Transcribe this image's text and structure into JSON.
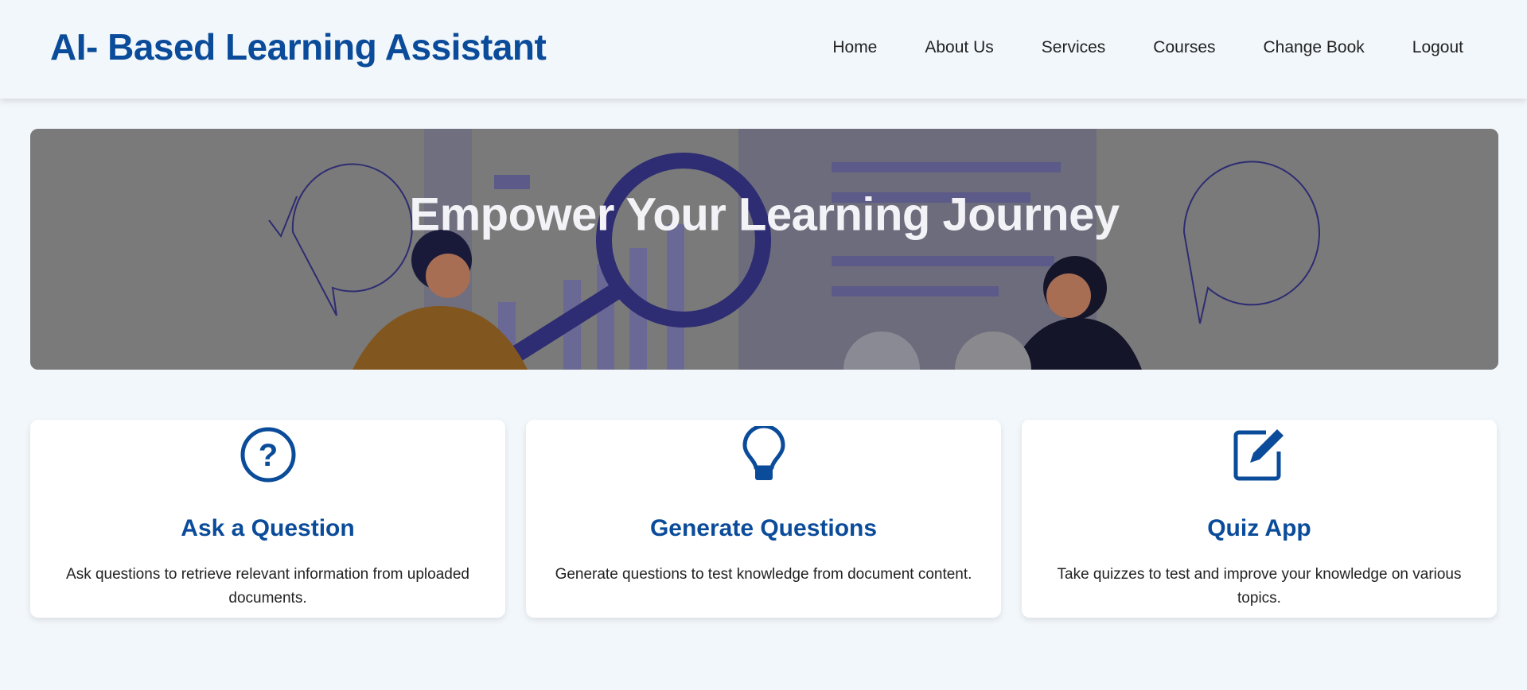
{
  "header": {
    "title": "AI- Based Learning Assistant",
    "nav": [
      "Home",
      "About Us",
      "Services",
      "Courses",
      "Change Book",
      "Logout"
    ]
  },
  "hero": {
    "title": "Empower Your Learning Journey"
  },
  "cards": [
    {
      "icon": "question-circle-icon",
      "title": "Ask a Question",
      "description": "Ask questions to retrieve relevant information from uploaded documents."
    },
    {
      "icon": "lightbulb-icon",
      "title": "Generate Questions",
      "description": "Generate questions to test knowledge from document content."
    },
    {
      "icon": "edit-icon",
      "title": "Quiz App",
      "description": "Take quizzes to test and improve your knowledge on various topics."
    }
  ],
  "colors": {
    "brand": "#0a4b9a",
    "background": "#f2f7fb"
  }
}
